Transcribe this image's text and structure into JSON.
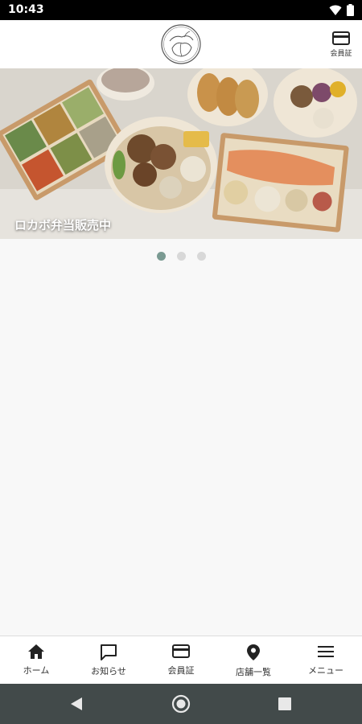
{
  "status_bar": {
    "time": "10:43",
    "icons": [
      "wifi-icon",
      "battery-icon"
    ]
  },
  "header": {
    "logo_icon": "brand-logo-icon",
    "member_card": {
      "icon": "card-icon",
      "label": "会員証"
    }
  },
  "carousel": {
    "caption": "ロカボ弁当販売中",
    "slide_count": 3,
    "active_index": 0,
    "accent_dot_color": "#7a9a92"
  },
  "bottom_nav": {
    "items": [
      {
        "icon": "home-icon",
        "label": "ホーム"
      },
      {
        "icon": "chat-icon",
        "label": "お知らせ"
      },
      {
        "icon": "card-icon",
        "label": "会員証"
      },
      {
        "icon": "location-pin-icon",
        "label": "店舗一覧"
      },
      {
        "icon": "hamburger-menu-icon",
        "label": "メニュー"
      }
    ]
  },
  "system_nav": [
    "back-icon",
    "home-circle-icon",
    "recent-apps-icon"
  ]
}
